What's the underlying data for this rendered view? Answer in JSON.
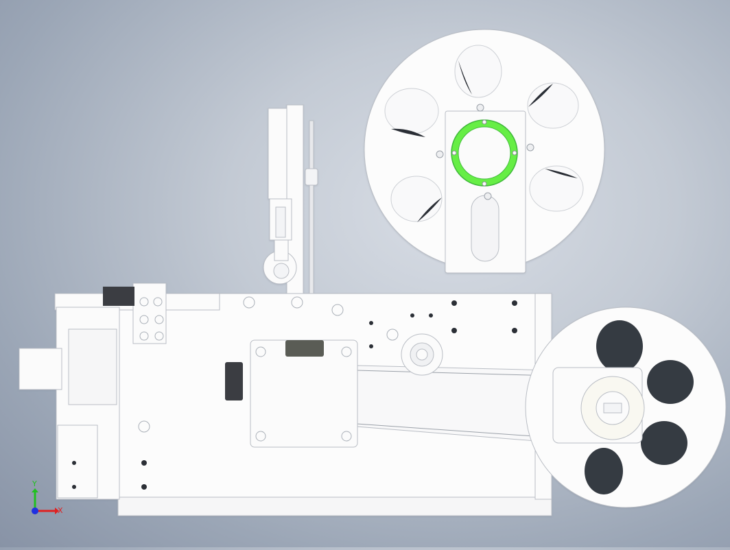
{
  "triad": {
    "x_label": "X",
    "y_label": "Y",
    "x_color": "#e02020",
    "y_color": "#20c020",
    "z_color": "#2030e0"
  },
  "colors": {
    "part_fill": "#fbfbfb",
    "edge": "#b9bdc4",
    "hole": "#2b2f36",
    "highlight_ring": "#66ee44",
    "background_center": "#d8dde5",
    "background_edge": "#8893a6"
  }
}
